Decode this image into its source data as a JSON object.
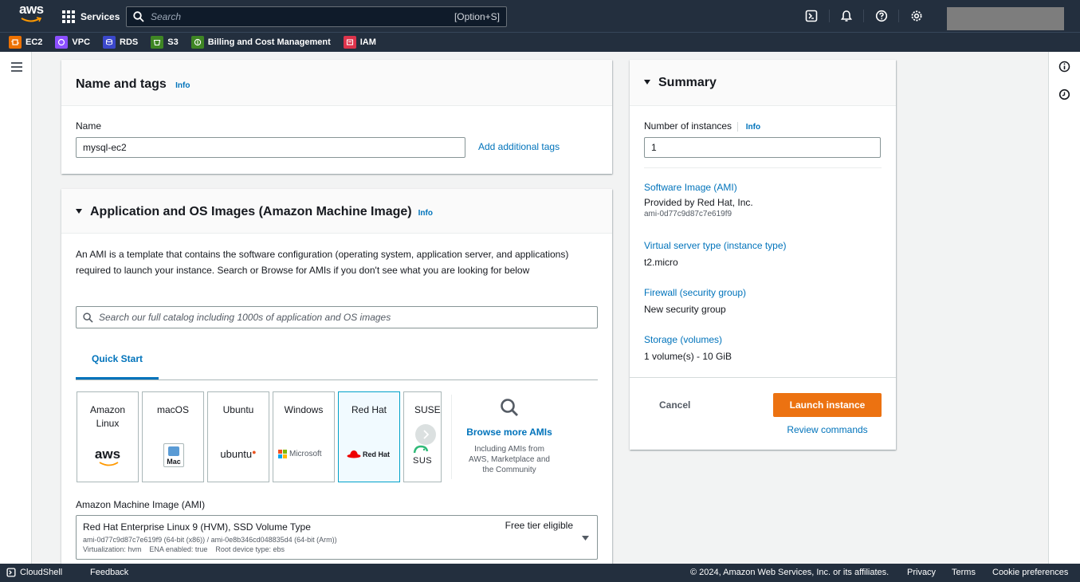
{
  "topnav": {
    "logo_text": "aws",
    "services_label": "Services",
    "search_placeholder": "Search",
    "search_shortcut": "[Option+S]"
  },
  "favorites": [
    {
      "label": "EC2",
      "color": "#ed7100"
    },
    {
      "label": "VPC",
      "color": "#8c4fff"
    },
    {
      "label": "RDS",
      "color": "#3b48cc"
    },
    {
      "label": "S3",
      "color": "#3f8624"
    },
    {
      "label": "Billing and Cost Management",
      "color": "#3f8624"
    },
    {
      "label": "IAM",
      "color": "#dd344c"
    }
  ],
  "name_panel": {
    "title": "Name and tags",
    "info": "Info",
    "name_label": "Name",
    "name_value": "mysql-ec2",
    "add_tags": "Add additional tags"
  },
  "ami_panel": {
    "title": "Application and OS Images (Amazon Machine Image)",
    "info": "Info",
    "description": "An AMI is a template that contains the software configuration (operating system, application server, and applications) required to launch your instance. Search or Browse for AMIs if you don't see what you are looking for below",
    "search_placeholder": "Search our full catalog including 1000s of application and OS images",
    "tab_label": "Quick Start",
    "tiles": [
      {
        "name": "Amazon\nLinux",
        "logo": "aws"
      },
      {
        "name": "macOS",
        "logo": "Mac"
      },
      {
        "name": "Ubuntu",
        "logo": "ubuntu"
      },
      {
        "name": "Windows",
        "logo": "Microsoft"
      },
      {
        "name": "Red Hat",
        "logo": "Red Hat"
      },
      {
        "name": "SUSE Li",
        "logo": "SUS"
      }
    ],
    "browse_label": "Browse more AMIs",
    "browse_sub": "Including AMIs from AWS, Marketplace and the Community",
    "ami_label": "Amazon Machine Image (AMI)",
    "ami_name": "Red Hat Enterprise Linux 9 (HVM), SSD Volume Type",
    "ami_ids": "ami-0d77c9d87c7e619f9 (64-bit (x86)) / ami-0e8b346cd048835d4 (64-bit (Arm))",
    "ami_meta": "Virtualization: hvm    ENA enabled: true    Root device type: ebs",
    "free_tier": "Free tier eligible"
  },
  "summary": {
    "title": "Summary",
    "num_instances_label": "Number of instances",
    "info": "Info",
    "num_instances_value": "1",
    "software_image_label": "Software Image (AMI)",
    "software_image_value": "Provided by Red Hat, Inc.",
    "software_image_sub": "ami-0d77c9d87c7e619f9",
    "instance_type_label": "Virtual server type (instance type)",
    "instance_type_value": "t2.micro",
    "firewall_label": "Firewall (security group)",
    "firewall_value": "New security group",
    "storage_label": "Storage (volumes)",
    "storage_value": "1 volume(s) - 10 GiB",
    "cancel": "Cancel",
    "launch": "Launch instance",
    "review": "Review commands"
  },
  "footer": {
    "cloudshell": "CloudShell",
    "feedback": "Feedback",
    "copyright": "© 2024, Amazon Web Services, Inc. or its affiliates.",
    "privacy": "Privacy",
    "terms": "Terms",
    "cookies": "Cookie preferences"
  }
}
